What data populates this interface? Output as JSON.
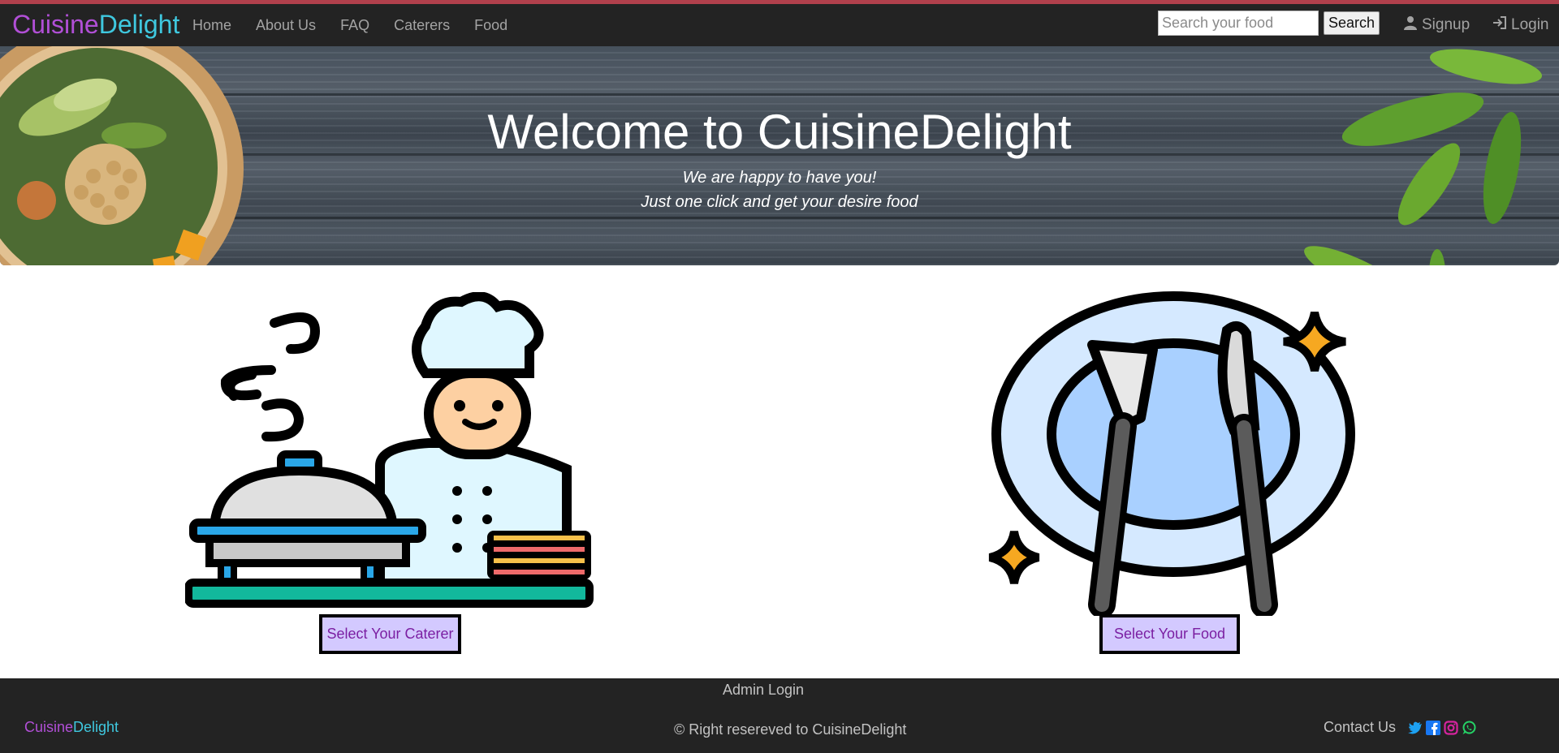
{
  "navbar": {
    "brand_part1": "Cuisine",
    "brand_part2": "Delight",
    "links": [
      "Home",
      "About Us",
      "FAQ",
      "Caterers",
      "Food"
    ],
    "search_placeholder": "Search your food",
    "search_label": "Search",
    "signup_label": "Signup",
    "login_label": "Login"
  },
  "hero": {
    "title": "Welcome to CuisineDelight",
    "subtitle_line1": "We are happy to have you!",
    "subtitle_line2": "Just one click and get your desire food"
  },
  "cards": {
    "caterer_label": "Select Your Caterer",
    "food_label": "Select Your Food"
  },
  "footer": {
    "admin_login": "Admin Login",
    "brand_part1": "Cuisine",
    "brand_part2": "Delight",
    "copyright": "© Right resereved to CuisineDelight",
    "contact": "Contact Us",
    "socials": [
      "twitter-icon",
      "facebook-icon",
      "instagram-icon",
      "whatsapp-icon"
    ]
  },
  "colors": {
    "brand_purple": "#b14fd6",
    "brand_cyan": "#3fc8df",
    "navbar_bg": "#232323",
    "accent_top": "#b1404c",
    "button_bg": "#d3c9ff",
    "button_text": "#7b1fa2"
  }
}
